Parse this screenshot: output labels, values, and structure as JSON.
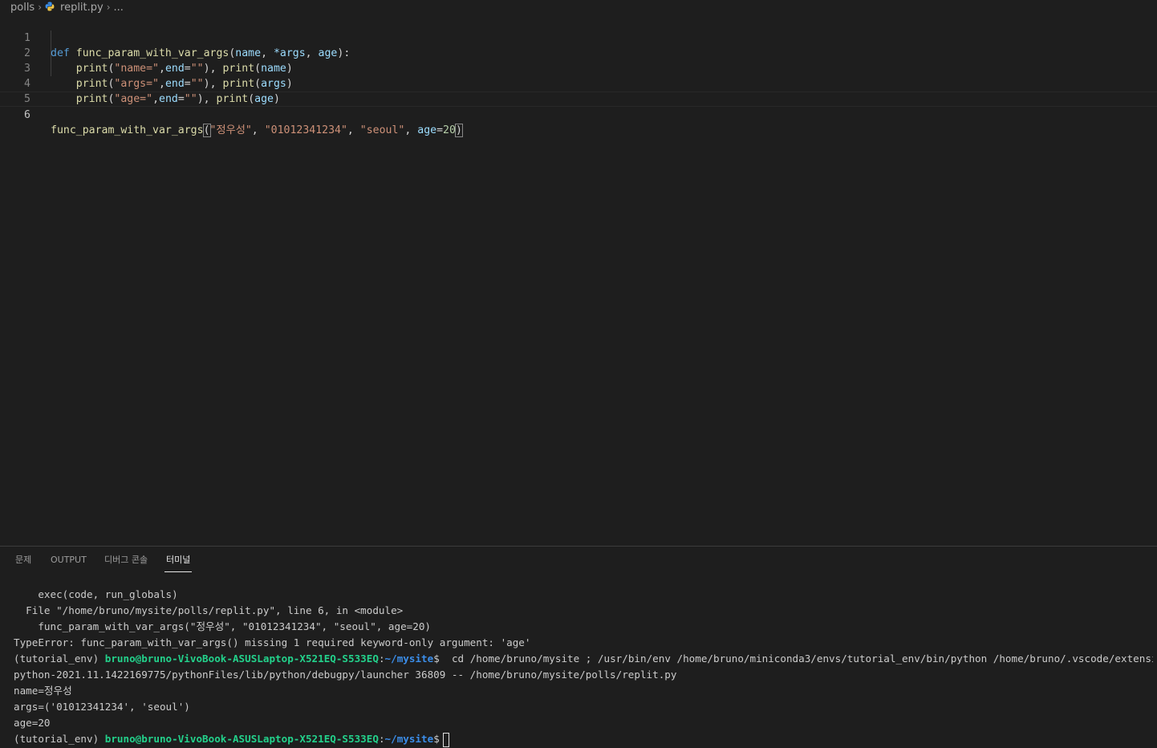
{
  "breadcrumb": {
    "folder": "polls",
    "file": "replit.py",
    "more": "..."
  },
  "editor": {
    "lines": [
      {
        "num": "1"
      },
      {
        "num": "2"
      },
      {
        "num": "3"
      },
      {
        "num": "4"
      },
      {
        "num": "5"
      },
      {
        "num": "6"
      }
    ],
    "tokens": {
      "def": "def",
      "func_name": "func_param_with_var_args",
      "param_name": "name",
      "param_args": "*args",
      "param_age": "age",
      "print": "print",
      "str_name": "\"name=\"",
      "str_args": "\"args=\"",
      "str_age": "\"age=\"",
      "end_kw": "end",
      "empty_str": "\"\"",
      "args_var": "args",
      "name_var": "name",
      "age_var": "age",
      "call_arg1": "\"정우성\"",
      "call_arg2": "\"01012341234\"",
      "call_arg3": "\"seoul\"",
      "call_age_kw": "age",
      "call_age_val": "20"
    }
  },
  "panel": {
    "tabs": [
      "문제",
      "OUTPUT",
      "디버그 콘솔",
      "터미널"
    ],
    "active_tab": "터미널"
  },
  "terminal": {
    "lines": [
      "    exec(code, run_globals)",
      "  File \"/home/bruno/mysite/polls/replit.py\", line 6, in <module>",
      "    func_param_with_var_args(\"정우성\", \"01012341234\", \"seoul\", age=20)",
      "TypeError: func_param_with_var_args() missing 1 required keyword-only argument: 'age'"
    ],
    "prompt_env": "(tutorial_env) ",
    "prompt_user": "bruno@bruno-VivoBook-ASUSLaptop-X521EQ-S533EQ",
    "prompt_colon": ":",
    "prompt_path": "~/mysite",
    "prompt_dollar": "$",
    "command": "  cd /home/bruno/mysite ; /usr/bin/env /home/bruno/miniconda3/envs/tutorial_env/bin/python /home/bruno/.vscode/extensions/ms-python.",
    "command_cont": "python-2021.11.1422169775/pythonFiles/lib/python/debugpy/launcher 36809 -- /home/bruno/mysite/polls/replit.py",
    "output": [
      "name=정우성",
      "args=('01012341234', 'seoul')",
      "age=20"
    ]
  },
  "colors": {
    "background": "#1e1e1e",
    "keyword": "#569cd6",
    "function": "#dcdcaa",
    "parameter": "#9cdcfe",
    "string": "#ce9178",
    "prompt_user": "#23d18b",
    "prompt_path": "#3b8eea"
  },
  "icons": {
    "file": "python-icon",
    "separator": "chevron-right-icon"
  }
}
